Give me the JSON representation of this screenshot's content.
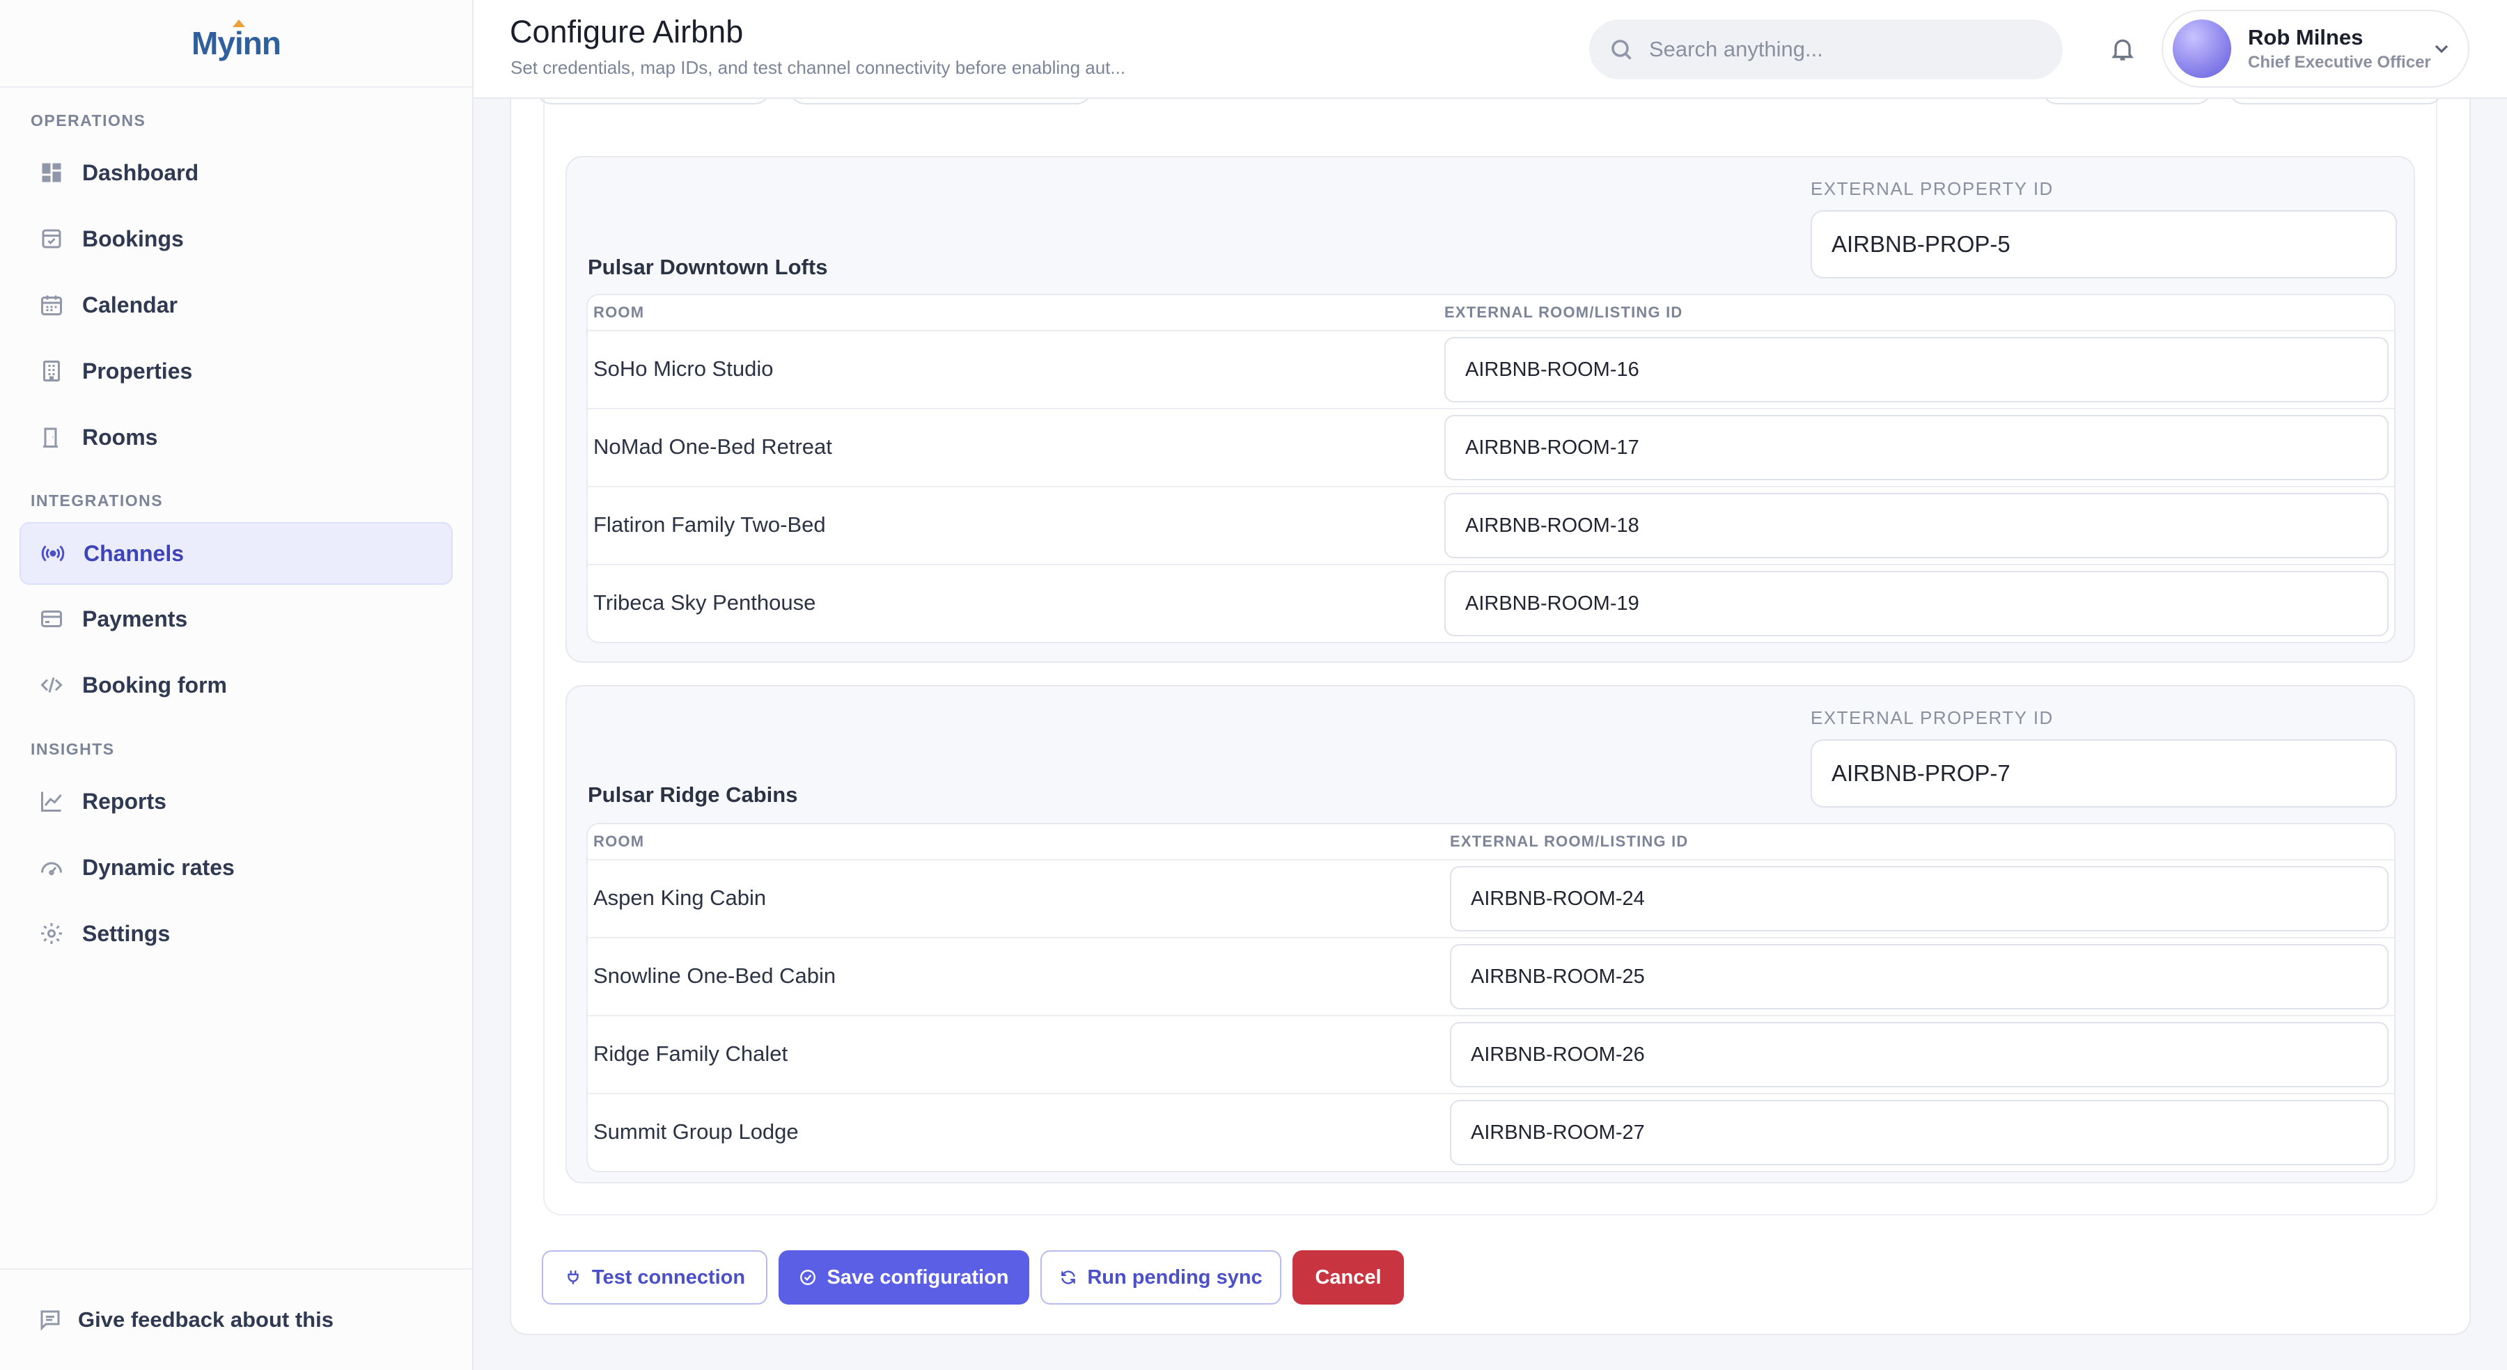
{
  "brand": {
    "logo": "Myinn"
  },
  "sidebar": {
    "sections": [
      {
        "label": "OPERATIONS"
      },
      {
        "label": "INTEGRATIONS"
      },
      {
        "label": "INSIGHTS"
      }
    ],
    "items": [
      {
        "label": "Dashboard",
        "icon": "dashboard-icon"
      },
      {
        "label": "Bookings",
        "icon": "bookings-icon"
      },
      {
        "label": "Calendar",
        "icon": "calendar-icon"
      },
      {
        "label": "Properties",
        "icon": "building-icon"
      },
      {
        "label": "Rooms",
        "icon": "door-icon"
      },
      {
        "label": "Channels",
        "icon": "broadcast-icon",
        "active": true
      },
      {
        "label": "Payments",
        "icon": "credit-card-icon"
      },
      {
        "label": "Booking form",
        "icon": "code-icon"
      },
      {
        "label": "Reports",
        "icon": "chart-line-icon"
      },
      {
        "label": "Dynamic rates",
        "icon": "gauge-icon"
      },
      {
        "label": "Settings",
        "icon": "gear-icon"
      }
    ],
    "feedback": "Give feedback about this"
  },
  "header": {
    "title": "Configure Airbnb",
    "subtitle": "Set credentials, map IDs, and test channel connectivity before enabling aut...",
    "search_placeholder": "Search anything..."
  },
  "user": {
    "name": "Rob Milnes",
    "role": "Chief Executive Officer"
  },
  "properties": [
    {
      "name": "Pulsar Downtown Lofts",
      "ext_label": "EXTERNAL PROPERTY ID",
      "ext_id": "AIRBNB-PROP-5",
      "col_room": "ROOM",
      "col_ext": "EXTERNAL ROOM/LISTING ID",
      "rooms": [
        {
          "name": "SoHo Micro Studio",
          "id": "AIRBNB-ROOM-16"
        },
        {
          "name": "NoMad One-Bed Retreat",
          "id": "AIRBNB-ROOM-17"
        },
        {
          "name": "Flatiron Family Two-Bed",
          "id": "AIRBNB-ROOM-18"
        },
        {
          "name": "Tribeca Sky Penthouse",
          "id": "AIRBNB-ROOM-19"
        }
      ]
    },
    {
      "name": "Pulsar Ridge Cabins",
      "ext_label": "EXTERNAL PROPERTY ID",
      "ext_id": "AIRBNB-PROP-7",
      "col_room": "ROOM",
      "col_ext": "EXTERNAL ROOM/LISTING ID",
      "rooms": [
        {
          "name": "Aspen King Cabin",
          "id": "AIRBNB-ROOM-24"
        },
        {
          "name": "Snowline One-Bed Cabin",
          "id": "AIRBNB-ROOM-25"
        },
        {
          "name": "Ridge Family Chalet",
          "id": "AIRBNB-ROOM-26"
        },
        {
          "name": "Summit Group Lodge",
          "id": "AIRBNB-ROOM-27"
        }
      ]
    }
  ],
  "actions": {
    "test": "Test connection",
    "save": "Save configuration",
    "sync": "Run pending sync",
    "cancel": "Cancel"
  },
  "colors": {
    "accent": "#5b5fe6",
    "danger": "#c8343f",
    "brand": "#2f5f9c"
  }
}
